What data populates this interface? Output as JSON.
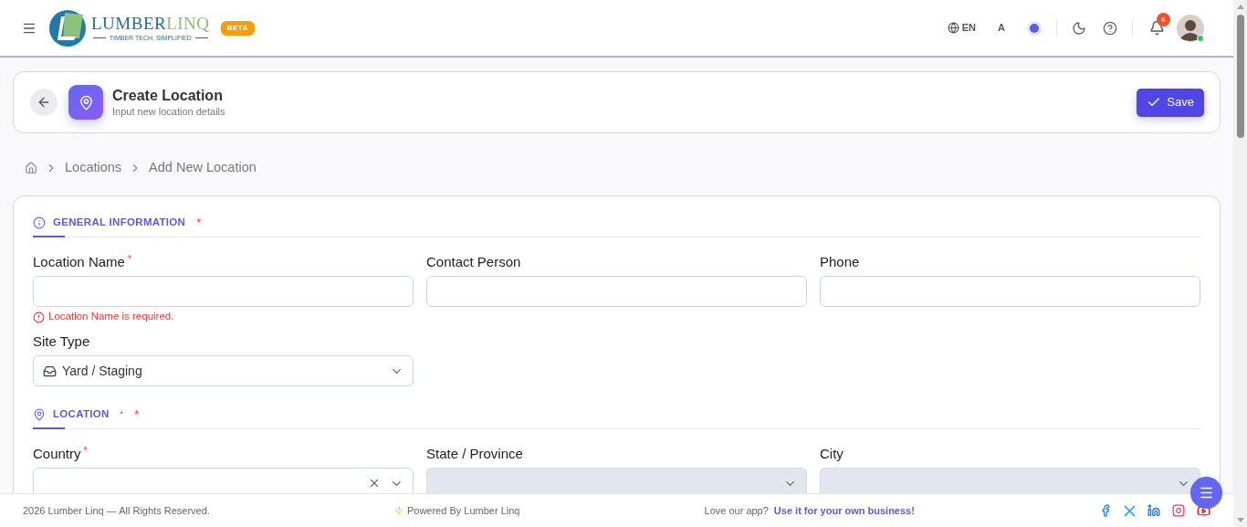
{
  "header": {
    "wordmark": [
      "LUMBER",
      "LINQ"
    ],
    "tagline": "TIMBER TECH, SIMPLIFIED",
    "badge": "BETA",
    "language": "EN",
    "font_size": "A",
    "notifications": "6",
    "user": {
      "online": true
    }
  },
  "page_header": {
    "title": "Create Location",
    "subtitle": "Input new location details",
    "save": "Save"
  },
  "breadcrumb": [
    "Locations",
    "Add New Location"
  ],
  "sections": [
    {
      "title": "GENERAL INFORMATION",
      "marks": [
        "*"
      ],
      "fields": [
        {
          "kind": "text",
          "label": "Location Name",
          "required": true,
          "error": "Location Name is required."
        },
        {
          "kind": "text",
          "label": "Contact Person"
        },
        {
          "kind": "text",
          "label": "Phone"
        },
        {
          "kind": "select",
          "label": "Site Type",
          "value": "Yard / Staging",
          "disabled": false
        }
      ]
    },
    {
      "title": "LOCATION",
      "marks": [
        "*",
        "*"
      ],
      "fields": [
        {
          "kind": "select",
          "label": "Country",
          "required": true,
          "disabled": false,
          "clearable": true
        },
        {
          "kind": "select",
          "label": "State / Province",
          "disabled": true
        },
        {
          "kind": "select",
          "label": "City",
          "disabled": true
        }
      ]
    }
  ],
  "footer": {
    "copyright": "2026 Lumber Linq — All Rights Reserved.",
    "powered": "Powered By Lumber Linq",
    "love": "Love our app?",
    "link": "Use it for your own business!"
  }
}
